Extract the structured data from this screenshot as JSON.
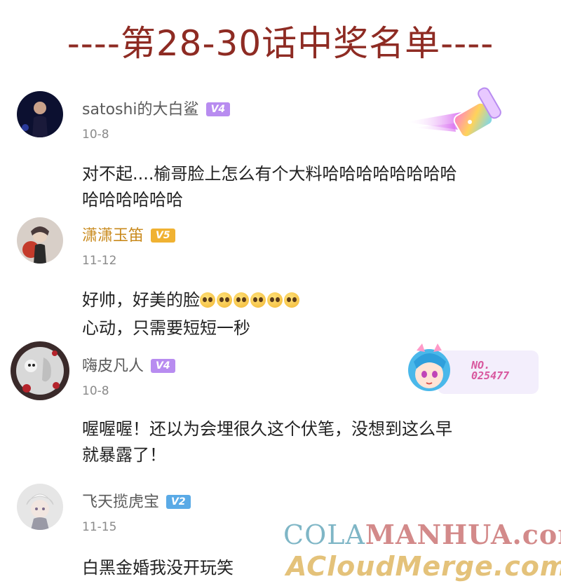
{
  "title": "----第28-30话中奖名单----",
  "colors": {
    "title": "#8e2b23",
    "badge_v4": "#b88cf0",
    "badge_v5": "#f0b232",
    "badge_v2": "#5aaae6"
  },
  "comments": [
    {
      "username": "satoshi的大白鲨",
      "level": "V4",
      "date": "10-8",
      "lines": [
        "对不起....榆哥脸上怎么有个大料哈哈哈哈哈哈哈哈",
        "哈哈哈哈哈哈"
      ],
      "decoration": "paintbrush-sticker"
    },
    {
      "username": "潇潇玉笛",
      "level": "V5",
      "date": "11-12",
      "lines": [
        "好帅，好美的脸",
        "心动，只需要短短一秒"
      ],
      "emoji_count": 6
    },
    {
      "username": "嗨皮凡人",
      "level": "V4",
      "date": "10-8",
      "lines": [
        "喔喔喔！还以为会埋很久这个伏笔，没想到这么早",
        "就暴露了！"
      ],
      "decoration": "number-badge",
      "decoration_text": "NO.\n025477"
    },
    {
      "username": "飞天揽虎宝",
      "level": "V2",
      "date": "11-15",
      "lines": [
        "白黑金婚我没开玩笑"
      ]
    }
  ],
  "watermark": {
    "part1": "COLA",
    "part2": "MANHUA.com",
    "line2": "ACloudMerge.com"
  }
}
